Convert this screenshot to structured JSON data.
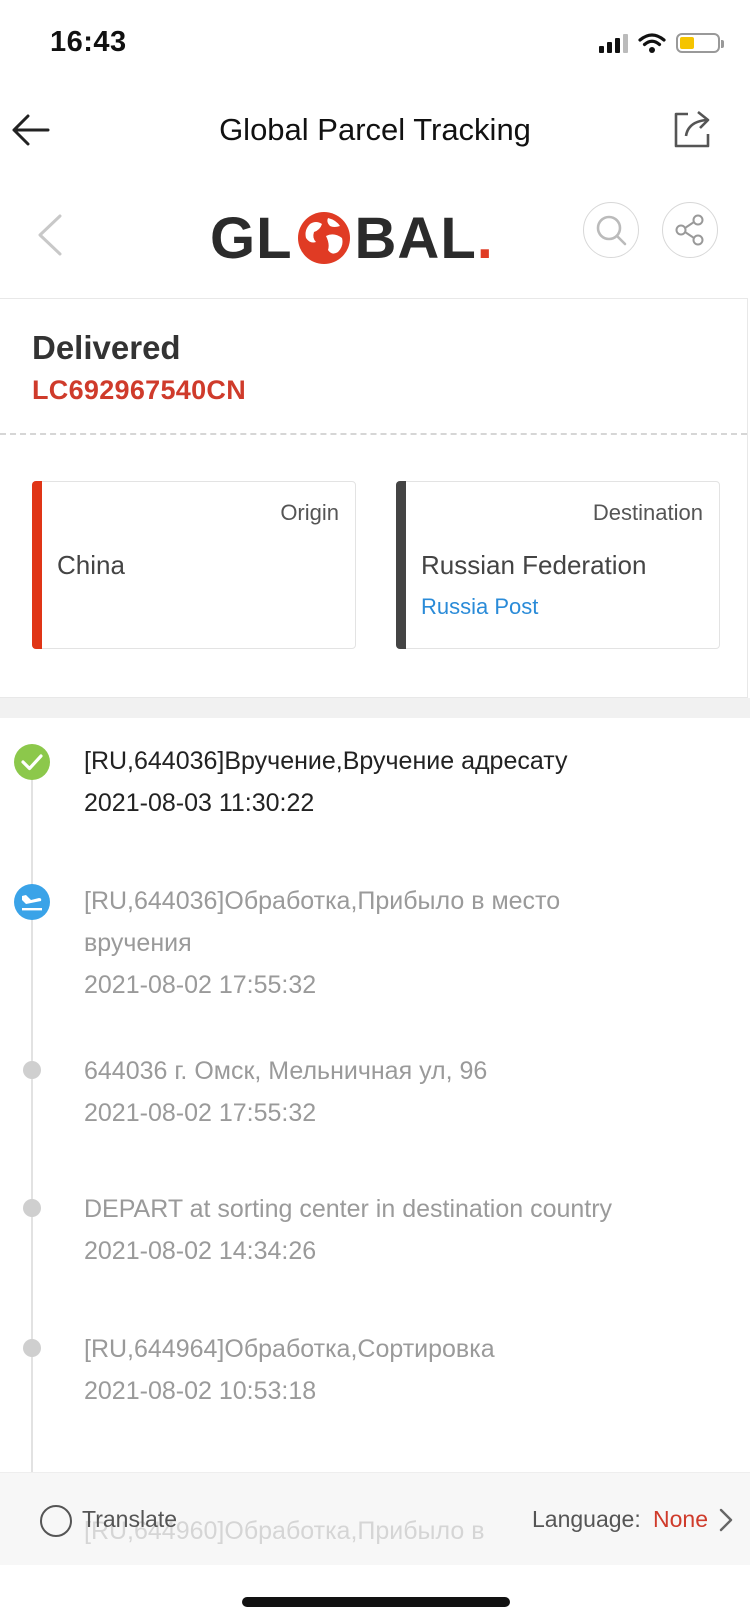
{
  "status_bar": {
    "time": "16:43",
    "icons": [
      "signal-icon",
      "wifi-icon",
      "battery-icon"
    ],
    "battery_color": "#f5c400"
  },
  "nav": {
    "title": "Global Parcel Tracking",
    "back_icon": "arrow-left-icon",
    "share_icon": "share-out-icon"
  },
  "brand": {
    "logo_prefix": "GL",
    "logo_suffix": "BAL",
    "logo_dot": ".",
    "prev_icon": "chevron-left-icon",
    "search_icon": "search-icon",
    "share_icon": "share-nodes-icon"
  },
  "shipment": {
    "status": "Delivered",
    "tracking_number": "LC692967540CN",
    "origin": {
      "label": "Origin",
      "country": "China",
      "carrier": ""
    },
    "destination": {
      "label": "Destination",
      "country": "Russian Federation",
      "carrier": "Russia Post"
    }
  },
  "events": [
    {
      "description": "[RU,644036]Вручение,Вручение адресату",
      "description_line2": "",
      "datetime": "2021-08-03 11:30:22",
      "icon": "check-circle-icon"
    },
    {
      "description": "[RU,644036]Обработка,Прибыло в место",
      "description_line2": "вручения",
      "datetime": "2021-08-02 17:55:32",
      "icon": "plane-landing-icon"
    },
    {
      "description": "644036 г. Омск, Мельничная ул, 96",
      "description_line2": "",
      "datetime": "2021-08-02 17:55:32",
      "icon": "dot-icon"
    },
    {
      "description": "DEPART at sorting center in destination country",
      "description_line2": "",
      "datetime": "2021-08-02 14:34:26",
      "icon": "dot-icon"
    },
    {
      "description": "[RU,644964]Обработка,Сортировка",
      "description_line2": "",
      "datetime": "2021-08-02 10:53:18",
      "icon": "dot-icon"
    },
    {
      "description": "[RU,644960]Обработка,Прибыло в",
      "description_line2": "",
      "datetime": "",
      "icon": "dot-icon"
    }
  ],
  "footer": {
    "translate_label": "Translate",
    "translate_checked": false,
    "language_label": "Language:",
    "language_value": "None"
  },
  "colors": {
    "accent_red": "#cf3b2b",
    "link_blue": "#2a8bd8",
    "delivered_green": "#8cc84b",
    "transit_blue": "#3aa3e8",
    "origin_bar": "#e03516",
    "destination_bar": "#444444"
  }
}
